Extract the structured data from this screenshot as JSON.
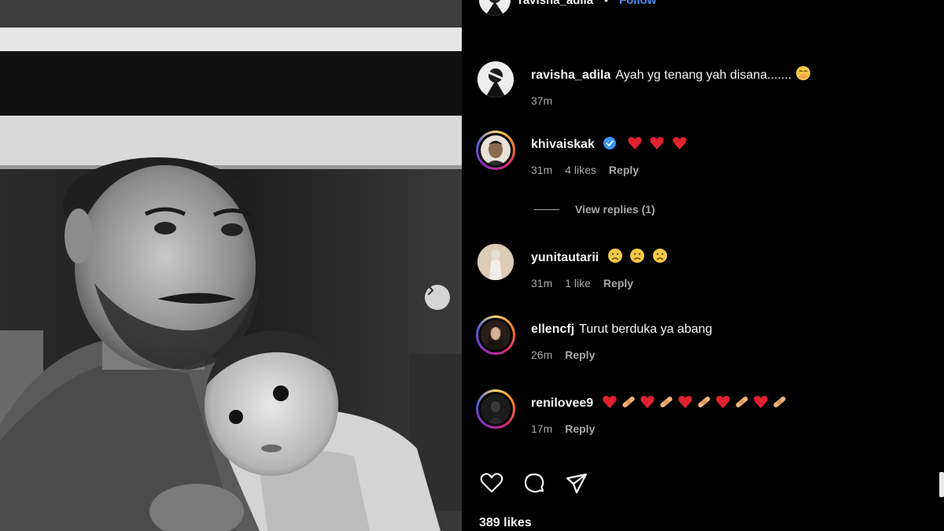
{
  "post": {
    "author": "ravisha_adila",
    "follow_label": "Follow",
    "separator": "•"
  },
  "comments": [
    {
      "username": "ravisha_adila",
      "text": "Ayah yg tenang yah disana.......",
      "emoji": "smiling-face-with-hand-over-mouth-emoji",
      "time": "37m",
      "likes": "",
      "reply_label": ""
    },
    {
      "username": "khivaiskak",
      "verified": true,
      "text": "",
      "emoji": "red-heart-emoji x3",
      "time": "31m",
      "likes": "4 likes",
      "reply_label": "Reply"
    },
    {
      "username": "yunitautarii",
      "text": "",
      "emoji": "sad-face-emoji x3",
      "time": "31m",
      "likes": "1 like",
      "reply_label": "Reply"
    },
    {
      "username": "ellencfj",
      "text": "Turut berduka ya abang",
      "time": "26m",
      "likes": "",
      "reply_label": "Reply"
    },
    {
      "username": "renilovee9",
      "text": "",
      "emoji": "heart-bandage-emoji pattern",
      "time": "17m",
      "likes": "",
      "reply_label": "Reply"
    }
  ],
  "view_replies": "View replies (1)",
  "actions": {
    "like_icon": "heart-icon",
    "comment_icon": "comment-icon",
    "share_icon": "send-icon"
  },
  "likes_count": "389 likes",
  "colors": {
    "background": "#000000",
    "text": "#f5f5f5",
    "muted": "#a8a8a8",
    "link": "#4c8ef5",
    "heart": "#e0212f"
  }
}
